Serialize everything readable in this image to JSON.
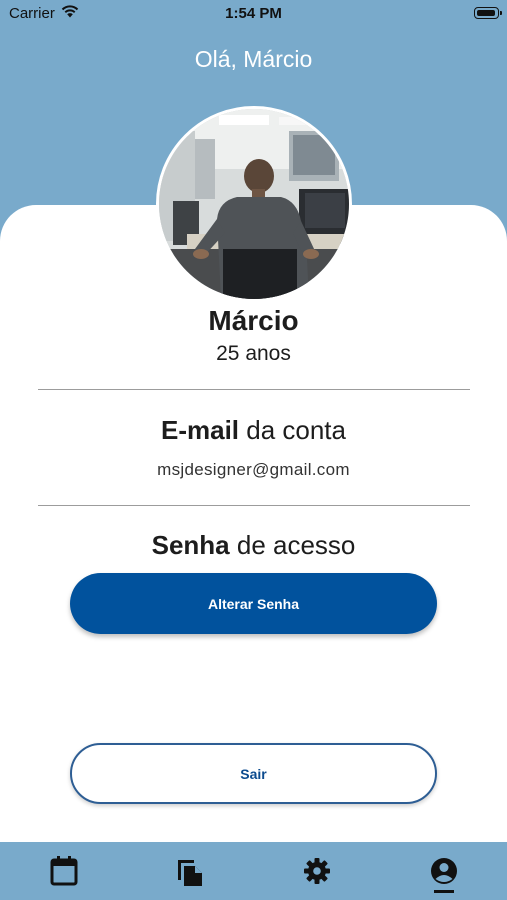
{
  "status_bar": {
    "carrier": "Carrier",
    "time": "1:54 PM"
  },
  "header": {
    "greeting": "Olá, Márcio"
  },
  "profile": {
    "name": "Márcio",
    "age": "25 anos"
  },
  "email_section": {
    "title_bold": "E-mail",
    "title_rest": " da conta",
    "value": "msjdesigner@gmail.com"
  },
  "password_section": {
    "title_bold": "Senha",
    "title_rest": " de acesso",
    "button_label": "Alterar Senha"
  },
  "logout": {
    "button_label": "Sair"
  },
  "bottom_nav": {
    "items": [
      {
        "icon": "calendar-icon"
      },
      {
        "icon": "documents-icon"
      },
      {
        "icon": "gear-icon"
      },
      {
        "icon": "profile-icon",
        "active": true
      }
    ]
  },
  "colors": {
    "header_background": "#79aacb",
    "primary_button": "#01529d",
    "outline_button": "#2e5e94"
  }
}
